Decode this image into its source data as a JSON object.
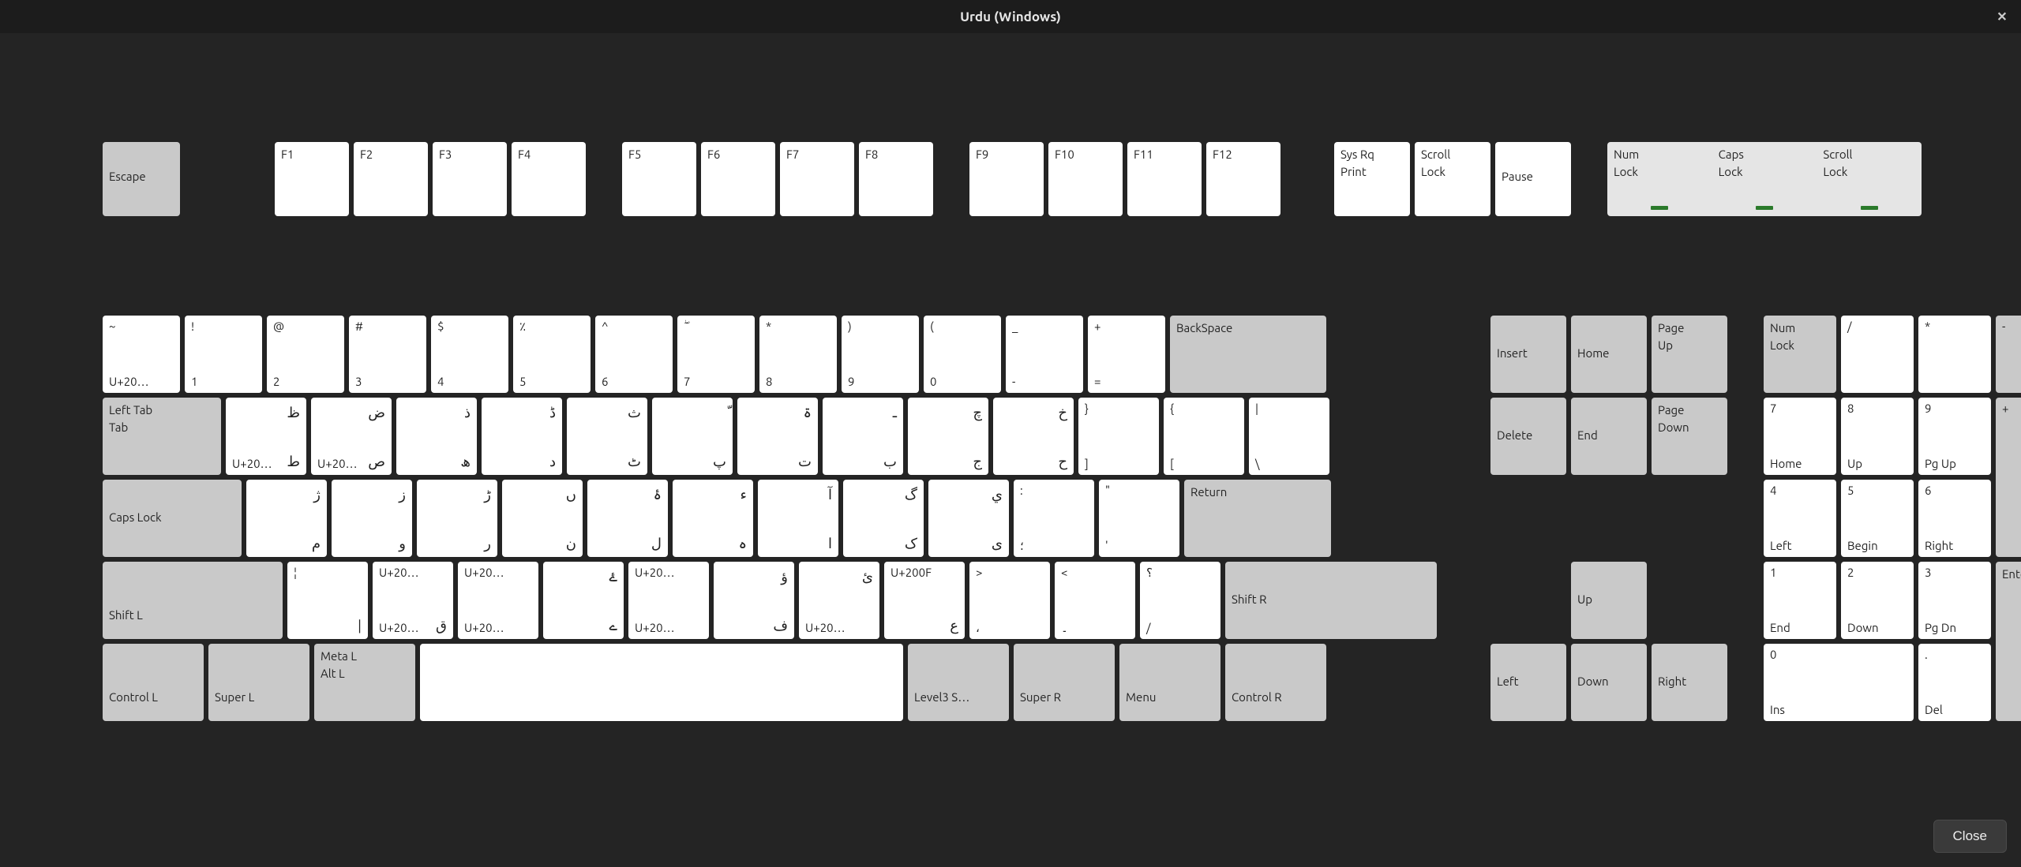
{
  "window": {
    "title": "Urdu (Windows)",
    "close_glyph": "✕"
  },
  "footer": {
    "close": "Close"
  },
  "sizes": {
    "h_fn": 94,
    "h_main": 98,
    "w_esc": 98,
    "w_fn": 94,
    "gap_esc": 114,
    "gap_fn_group": 40,
    "w_std": 98,
    "w_backspace": 198,
    "w_tab": 150,
    "w_tab_key": 102,
    "w_bslash": 102,
    "w_caps": 176,
    "w_caps_key": 102,
    "w_return": 186,
    "w_shiftl": 228,
    "w_shift_key": 102,
    "w_shiftr": 268,
    "w_ctrl": 128,
    "w_super": 128,
    "w_meta": 128,
    "w_space": 612,
    "w_altgr": 128,
    "w_superr": 128,
    "w_menu": 128,
    "w_ctrlr": 128,
    "gap_main_nav": 62,
    "w_nav": 96,
    "gap_nav_num": 40,
    "w_num": 92,
    "w_num_wide": 190,
    "h_num_tall": 202
  },
  "fnrow": {
    "escape": "Escape",
    "f": [
      "F1",
      "F2",
      "F3",
      "F4",
      "F5",
      "F6",
      "F7",
      "F8",
      "F9",
      "F10",
      "F11",
      "F12"
    ],
    "sysrq": {
      "l1": "Sys Rq",
      "l2": "Print"
    },
    "scroll": {
      "l1": "Scroll",
      "l2": "Lock"
    },
    "pause": "Pause",
    "locks": {
      "num": {
        "l1": "Num",
        "l2": "Lock"
      },
      "caps": {
        "l1": "Caps",
        "l2": "Lock"
      },
      "scroll": {
        "l1": "Scroll",
        "l2": "Lock"
      }
    }
  },
  "row1": [
    {
      "tl": "~",
      "bl": "U+20…",
      "tr": "",
      "br": ""
    },
    {
      "tl": "!",
      "bl": "1",
      "tr": "",
      "br": ""
    },
    {
      "tl": "@",
      "bl": "2",
      "tr": "",
      "br": ""
    },
    {
      "tl": "#",
      "bl": "3",
      "tr": "",
      "br": ""
    },
    {
      "tl": "$",
      "bl": "4",
      "tr": "",
      "br": ""
    },
    {
      "tl": "٪",
      "bl": "5",
      "tr": "",
      "br": ""
    },
    {
      "tl": "^",
      "bl": "6",
      "tr": "",
      "br": ""
    },
    {
      "tl": "ۖ",
      "bl": "7",
      "tr": "",
      "br": ""
    },
    {
      "tl": "*",
      "bl": "8",
      "tr": "",
      "br": ""
    },
    {
      "tl": ")",
      "bl": "9",
      "tr": "",
      "br": ""
    },
    {
      "tl": "(",
      "bl": "0",
      "tr": "",
      "br": ""
    },
    {
      "tl": "_",
      "bl": "-",
      "tr": "",
      "br": ""
    },
    {
      "tl": "+",
      "bl": "=",
      "tr": "",
      "br": ""
    }
  ],
  "backspace": "BackSpace",
  "row2": {
    "tab": {
      "l1": "Left Tab",
      "l2": "Tab"
    },
    "keys": [
      {
        "tl": "",
        "bl": "U+20…",
        "tr": "ظ",
        "br": "ط"
      },
      {
        "tl": "",
        "bl": "U+20…",
        "tr": "ض",
        "br": "ص"
      },
      {
        "tl": "",
        "bl": "",
        "tr": "ذ",
        "br": "ھ"
      },
      {
        "tl": "",
        "bl": "",
        "tr": "ڈ",
        "br": "د"
      },
      {
        "tl": "",
        "bl": "",
        "tr": "ث",
        "br": "ٹ"
      },
      {
        "tl": "",
        "bl": "",
        "tr": "ّ",
        "br": "پ"
      },
      {
        "tl": "",
        "bl": "",
        "tr": "ۃ",
        "br": "ت"
      },
      {
        "tl": "",
        "bl": "",
        "tr": "ـ",
        "br": "ب"
      },
      {
        "tl": "",
        "bl": "",
        "tr": "چ",
        "br": "ج"
      },
      {
        "tl": "",
        "bl": "",
        "tr": "خ",
        "br": "ح"
      },
      {
        "tl": "}",
        "bl": "]",
        "tr": "",
        "br": ""
      },
      {
        "tl": "{",
        "bl": "[",
        "tr": "",
        "br": ""
      }
    ],
    "backslash": {
      "tl": "|",
      "bl": "\\",
      "tr": "",
      "br": ""
    }
  },
  "row3": {
    "caps": "Caps Lock",
    "keys": [
      {
        "tl": "",
        "bl": "",
        "tr": "ژ",
        "br": "م"
      },
      {
        "tl": "",
        "bl": "",
        "tr": "ز",
        "br": "و"
      },
      {
        "tl": "",
        "bl": "",
        "tr": "ڑ",
        "br": "ر"
      },
      {
        "tl": "",
        "bl": "",
        "tr": "ں",
        "br": "ن"
      },
      {
        "tl": "",
        "bl": "",
        "tr": "ۂ",
        "br": "ل"
      },
      {
        "tl": "",
        "bl": "",
        "tr": "ء",
        "br": "ہ"
      },
      {
        "tl": "",
        "bl": "",
        "tr": "آ",
        "br": "ا"
      },
      {
        "tl": "",
        "bl": "",
        "tr": "گ",
        "br": "ک"
      },
      {
        "tl": "",
        "bl": "",
        "tr": "ي",
        "br": "ی"
      },
      {
        "tl": ":",
        "bl": "؛",
        "tr": "",
        "br": ""
      },
      {
        "tl": "\"",
        "bl": "'",
        "tr": "",
        "br": ""
      }
    ],
    "return": "Return"
  },
  "row4": {
    "shiftl": "Shift L",
    "keys": [
      {
        "tl": "¦",
        "bl": "",
        "tr": "",
        "br": "|"
      },
      {
        "tl": "U+20…",
        "bl": "U+20…",
        "tr": "",
        "br": "ق"
      },
      {
        "tl": "U+20…",
        "bl": "U+20…",
        "tr": "",
        "br": ""
      },
      {
        "tl": "",
        "bl": "",
        "tr": "ۓ",
        "br": "ے"
      },
      {
        "tl": "U+20…",
        "bl": "U+20…",
        "tr": "",
        "br": ""
      },
      {
        "tl": "",
        "bl": "",
        "tr": "ؤ",
        "br": "ف"
      },
      {
        "tl": "",
        "bl": "U+20…",
        "tr": "ئ",
        "br": ""
      },
      {
        "tl": "U+200F",
        "bl": "",
        "tr": "",
        "br": "ع"
      },
      {
        "tl": ">",
        "bl": "،",
        "tr": "",
        "br": ""
      },
      {
        "tl": "<",
        "bl": "۔",
        "tr": "",
        "br": ""
      },
      {
        "tl": "؟",
        "bl": "/",
        "tr": "",
        "br": ""
      }
    ],
    "shiftr": "Shift R"
  },
  "row5": {
    "ctrl_l": "Control L",
    "super_l": "Super L",
    "meta": {
      "l1": "Meta L",
      "l2": "Alt L"
    },
    "altgr": "Level3 S…",
    "super_r": "Super R",
    "menu": "Menu",
    "ctrl_r": "Control R"
  },
  "nav": {
    "insert": "Insert",
    "home": "Home",
    "pgup": {
      "l1": "Page",
      "l2": "Up"
    },
    "delete": "Delete",
    "end": "End",
    "pgdn": {
      "l1": "Page",
      "l2": "Down"
    },
    "up": "Up",
    "left": "Left",
    "down": "Down",
    "right": "Right"
  },
  "numpad": {
    "numlock": {
      "l1": "Num",
      "l2": "Lock"
    },
    "slash": "/",
    "star": "*",
    "minus": "-",
    "plus": "+",
    "enter": "Enter",
    "k7": {
      "t": "7",
      "b": "Home"
    },
    "k8": {
      "t": "8",
      "b": "Up"
    },
    "k9": {
      "t": "9",
      "b": "Pg Up"
    },
    "k4": {
      "t": "4",
      "b": "Left"
    },
    "k5": {
      "t": "5",
      "b": "Begin"
    },
    "k6": {
      "t": "6",
      "b": "Right"
    },
    "k1": {
      "t": "1",
      "b": "End"
    },
    "k2": {
      "t": "2",
      "b": "Down"
    },
    "k3": {
      "t": "3",
      "b": "Pg Dn"
    },
    "k0": {
      "t": "0",
      "b": "Ins"
    },
    "dot": {
      "t": ".",
      "b": "Del"
    }
  }
}
